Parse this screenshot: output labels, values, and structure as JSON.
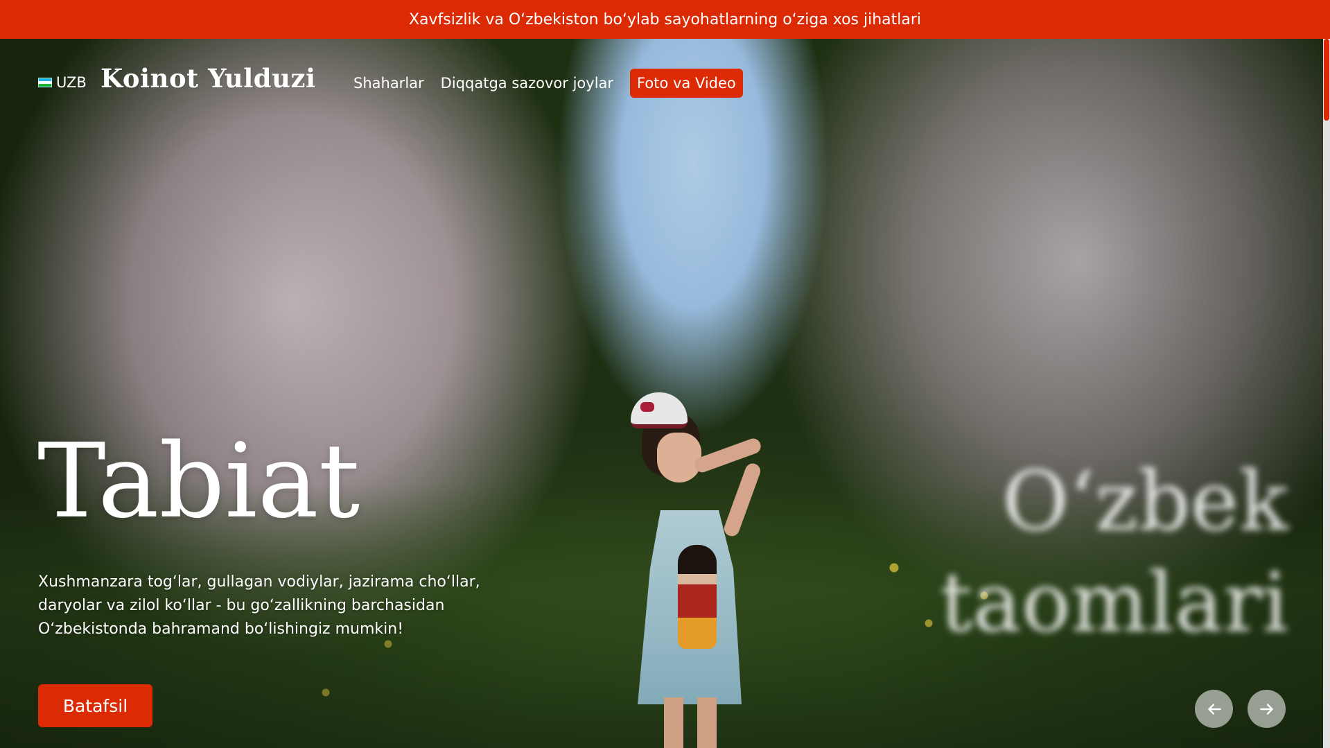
{
  "banner": {
    "text": "Xavfsizlik va O‘zbekiston bo‘ylab sayohatlarning o‘ziga xos jihatlari"
  },
  "header": {
    "language": {
      "flag_icon": "uzbekistan-flag-icon",
      "label": "UZB"
    },
    "logo": "Koinot Yulduzi",
    "nav": [
      {
        "label": "Shaharlar",
        "active": false
      },
      {
        "label": "Diqqatga sazovor joylar",
        "active": false
      },
      {
        "label": "Foto va Video",
        "active": true
      }
    ]
  },
  "hero": {
    "title": "Tabiat",
    "description": "Xushmanzara tog‘lar, gullagan vodiylar, jazirama cho‘llar, daryolar va zilol ko‘llar - bu go‘zallikning barchasidan O‘zbekistonda bahramand bo‘lishingiz mumkin!",
    "cta_label": "Batafsil",
    "next_slide_title": "O‘zbek taomlari",
    "prev_icon": "arrow-left-icon",
    "next_icon": "arrow-right-icon"
  },
  "colors": {
    "accent": "#dc2a05",
    "text": "#ffffff"
  }
}
